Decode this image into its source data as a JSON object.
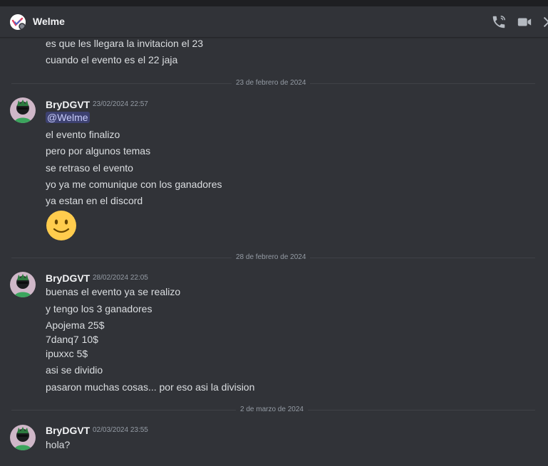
{
  "header": {
    "title": "Welme",
    "icons": [
      "voice-call-icon",
      "video-call-icon",
      "pin-icon"
    ]
  },
  "messages_top": [
    "es que les llegara la invitacion el 23",
    "cuando el evento es el 22 jaja"
  ],
  "dividers": [
    "23 de febrero de 2024",
    "28 de febrero de 2024",
    "2 de marzo de 2024"
  ],
  "groups": [
    {
      "author": "BryDGVT",
      "timestamp": "23/02/2024 22:57",
      "mention": "@Welme",
      "lines": [
        "el evento finalizo",
        "pero por algunos temas",
        "se retraso el evento",
        "yo ya me comunique con los ganadores",
        "ya estan en el discord"
      ],
      "emoji": "slightly-smiling-face"
    },
    {
      "author": "BryDGVT",
      "timestamp": "28/02/2024 22:05",
      "lines": [
        "buenas el evento ya se realizo",
        "y tengo los 3 ganadores",
        "Apojema 25$",
        "7danq7 10$",
        "ipuxxc 5$",
        "asi se dividio",
        "pasaron muchas cosas... por eso asi la division"
      ]
    },
    {
      "author": "BryDGVT",
      "timestamp": "02/03/2024 23:55",
      "lines": [
        "hola?"
      ]
    }
  ],
  "colors": {
    "background": "#313338",
    "text": "#dbdee1",
    "muted": "#949ba4",
    "mention_bg": "#414675",
    "avatar_green": "#3ba55d"
  }
}
